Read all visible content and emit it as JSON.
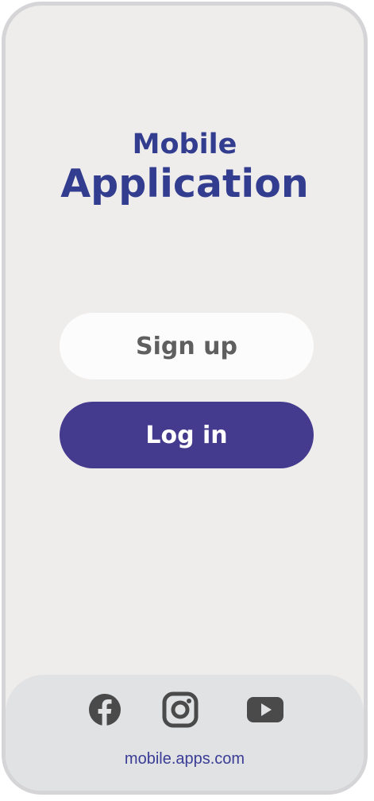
{
  "app": {
    "title_line1": "Mobile",
    "title_line2": "Application"
  },
  "buttons": {
    "signup_label": "Sign up",
    "login_label": "Log in"
  },
  "footer": {
    "social_icons": [
      "facebook-icon",
      "instagram-icon",
      "youtube-icon"
    ],
    "url": "mobile.apps.com"
  },
  "colors": {
    "brand": "#323d8f",
    "login_button": "#453b8e",
    "background": "#efedec",
    "footer": "#e1e2e4"
  }
}
